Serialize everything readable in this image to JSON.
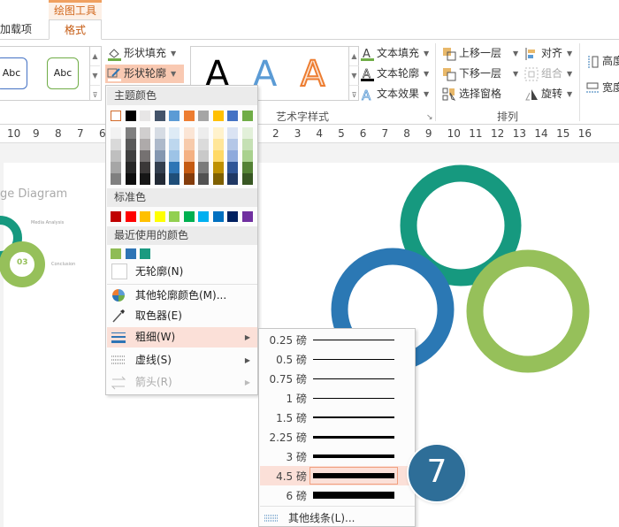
{
  "ribbon": {
    "contextual_tab": "绘图工具",
    "tabs": [
      {
        "label": "加载项"
      },
      {
        "label": "格式"
      }
    ],
    "shape_styles": {
      "samples": [
        "Abc",
        "Abc"
      ]
    },
    "shape_fill": "形状填充",
    "shape_outline": "形状轮廓",
    "wordart_samples": [
      "A",
      "A",
      "A"
    ],
    "text_fill": "文本填充",
    "text_outline": "文本轮廓",
    "text_effects": "文本效果",
    "wordart_group": "艺术字样式",
    "bring_forward": "上移一层",
    "send_backward": "下移一层",
    "selection_pane": "选择窗格",
    "align": "对齐",
    "group": "组合",
    "rotate": "旋转",
    "arrange_group": "排列",
    "height": "高度",
    "width": "宽度"
  },
  "ruler": {
    "left": [
      "10",
      "9",
      "8",
      "7",
      "6"
    ],
    "right": [
      "2",
      "3",
      "4",
      "5",
      "6",
      "7",
      "8",
      "9",
      "10",
      "11",
      "12",
      "13",
      "14",
      "15",
      "16"
    ]
  },
  "slide_thumb": {
    "title": "ge Diagram",
    "item1": "Media Analysis",
    "item2": "Conclusion",
    "number": "03"
  },
  "outline_menu": {
    "theme_colors_label": "主题颜色",
    "theme_colors": [
      "#ffffff",
      "#000000",
      "#e7e6e6",
      "#44546a",
      "#5b9bd5",
      "#ed7d31",
      "#a5a5a5",
      "#ffc000",
      "#4472c4",
      "#70ad47"
    ],
    "theme_shades": [
      [
        "#f2f2f2",
        "#d9d9d9",
        "#bfbfbf",
        "#a6a6a6",
        "#808080"
      ],
      [
        "#7f7f7f",
        "#595959",
        "#404040",
        "#262626",
        "#0d0d0d"
      ],
      [
        "#d0cece",
        "#aeaaaa",
        "#757171",
        "#3b3838",
        "#161616"
      ],
      [
        "#d6dce4",
        "#adb9ca",
        "#8497b0",
        "#333f4f",
        "#222a35"
      ],
      [
        "#deebf6",
        "#bdd7ee",
        "#9dc3e6",
        "#2e75b5",
        "#1f4e79"
      ],
      [
        "#fbe5d5",
        "#f7cbac",
        "#f4b183",
        "#c55a11",
        "#843c0b"
      ],
      [
        "#ededed",
        "#dbdbdb",
        "#c9c9c9",
        "#7b7b7b",
        "#525252"
      ],
      [
        "#fff2cc",
        "#ffe699",
        "#ffd966",
        "#bf9000",
        "#7f6000"
      ],
      [
        "#dae3f3",
        "#b4c7e7",
        "#8faadc",
        "#2f5597",
        "#203864"
      ],
      [
        "#e2f0d9",
        "#c5e0b4",
        "#a9d18e",
        "#548235",
        "#385723"
      ]
    ],
    "standard_colors_label": "标准色",
    "standard_colors": [
      "#c00000",
      "#ff0000",
      "#ffc000",
      "#ffff00",
      "#92d050",
      "#00b050",
      "#00b0f0",
      "#0070c0",
      "#002060",
      "#7030a0"
    ],
    "recent_colors_label": "最近使用的颜色",
    "recent_colors": [
      "#8fbc55",
      "#2e75b5",
      "#1a9a80"
    ],
    "no_outline": "无轮廓(N)",
    "more_colors": "其他轮廓颜色(M)...",
    "eyedropper": "取色器(E)",
    "weight": "粗细(W)",
    "dashes": "虚线(S)",
    "arrows": "箭头(R)"
  },
  "weight_menu": {
    "items": [
      {
        "label": "0.25 磅",
        "pt": 0.25
      },
      {
        "label": "0.5 磅",
        "pt": 0.5
      },
      {
        "label": "0.75 磅",
        "pt": 0.75
      },
      {
        "label": "1 磅",
        "pt": 1
      },
      {
        "label": "1.5 磅",
        "pt": 1.5
      },
      {
        "label": "2.25 磅",
        "pt": 2.25
      },
      {
        "label": "3 磅",
        "pt": 3
      },
      {
        "label": "4.5 磅",
        "pt": 4.5
      },
      {
        "label": "6 磅",
        "pt": 6
      }
    ],
    "selected": "4.5 磅",
    "more_lines": "其他线条(L)..."
  },
  "step_badge": "7",
  "colors": {
    "teal": "#16997f",
    "blue": "#2b78b4",
    "green": "#96c05a",
    "accent": "#c55a11"
  }
}
